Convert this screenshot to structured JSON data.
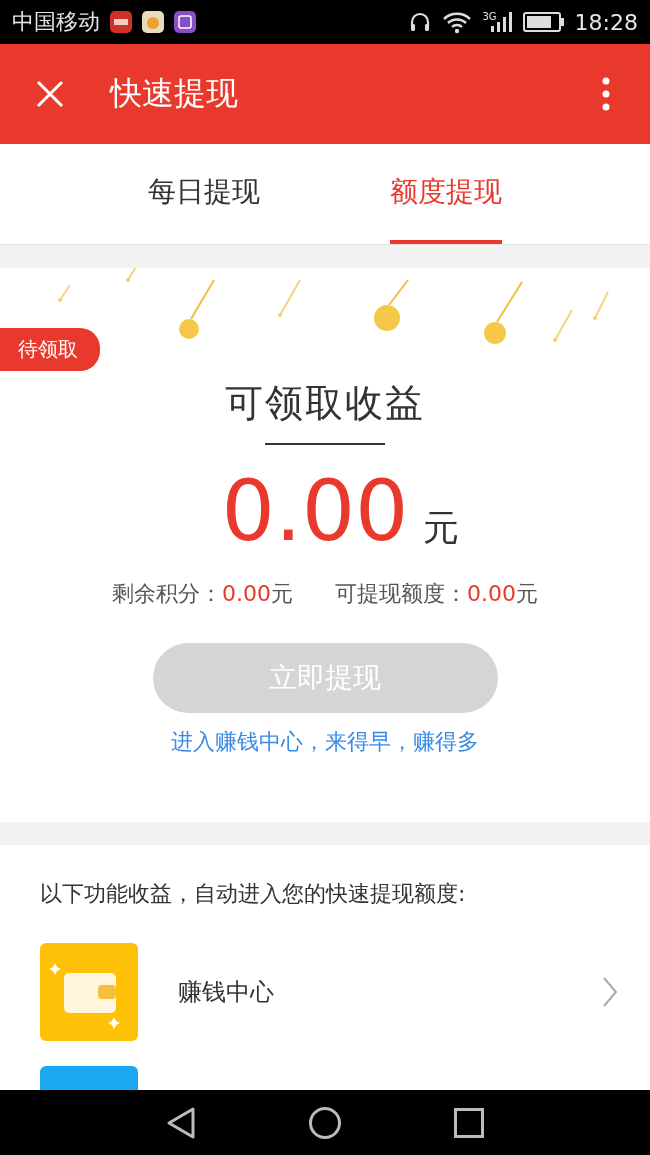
{
  "status_bar": {
    "carrier": "中国移动",
    "network": "3G",
    "time": "18:28"
  },
  "header": {
    "title": "快速提现"
  },
  "tabs": [
    {
      "label": "每日提现",
      "selected": false
    },
    {
      "label": "额度提现",
      "selected": true
    }
  ],
  "reward_card": {
    "badge": "待领取",
    "title": "可领取收益",
    "amount": "0.00",
    "unit": "元",
    "stats": [
      {
        "label": "剩余积分：",
        "value": "0.00",
        "unit": "元"
      },
      {
        "label": "可提现额度：",
        "value": "0.00",
        "unit": "元"
      }
    ],
    "button": {
      "label": "立即提现",
      "disabled": true
    },
    "link": "进入赚钱中心，来得早，赚得多"
  },
  "features": {
    "intro": "以下功能收益，自动进入您的快速提现额度:",
    "items": [
      {
        "label": "赚钱中心",
        "color": "#ffc107"
      },
      {
        "color": "#1aa8f0"
      }
    ]
  }
}
